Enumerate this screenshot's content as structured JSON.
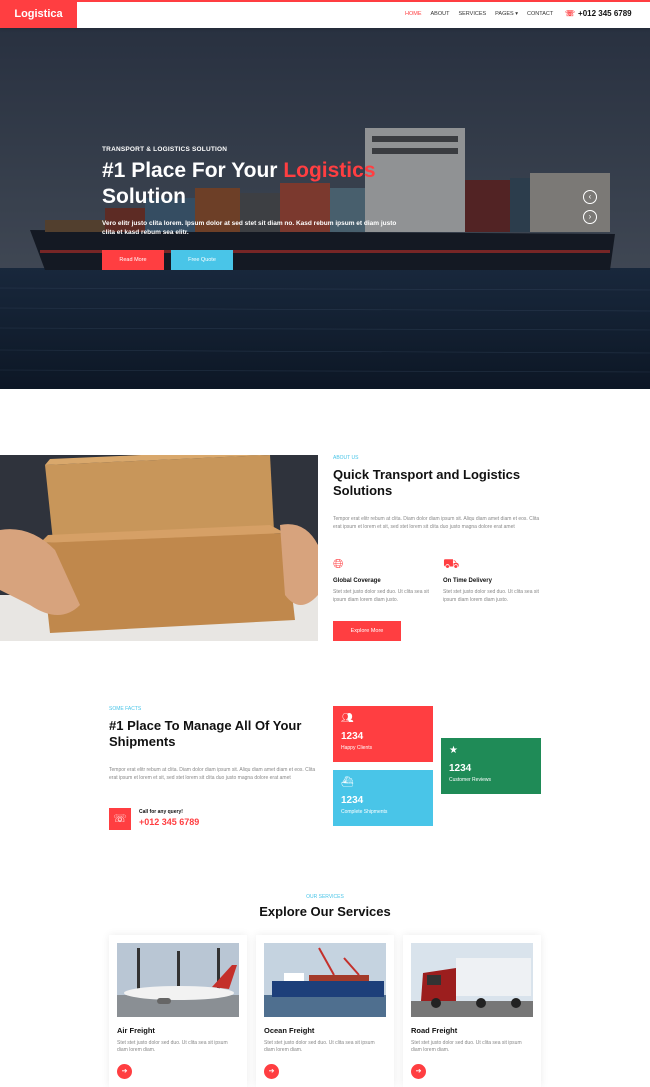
{
  "nav": {
    "brand": "Logistica",
    "items": [
      {
        "label": "HOME",
        "active": true
      },
      {
        "label": "ABOUT"
      },
      {
        "label": "SERVICES"
      },
      {
        "label": "PAGES ▾"
      },
      {
        "label": "CONTACT"
      }
    ],
    "phone": "+012 345 6789",
    "phone_icon": "headset-icon"
  },
  "hero": {
    "kicker": "TRANSPORT & LOGISTICS SOLUTION",
    "title_part1": "#1 Place For Your ",
    "title_highlight": "Logistics",
    "title_part2": "Solution",
    "text": "Vero elitr justo clita lorem. Ipsum dolor at sed stet sit diam no. Kasd rebum ipsum et diam justo clita et kasd rebum sea elitr.",
    "btn_primary": "Read More",
    "btn_secondary": "Free Quote",
    "prev_icon": "chevron-left-icon",
    "next_icon": "chevron-right-icon"
  },
  "about": {
    "kicker": "ABOUT US",
    "title": "Quick Transport and Logistics Solutions",
    "text": "Tempor erat elitr rebum at clita. Diam dolor diam ipsum sit. Aliqu diam amet diam et eos. Clita erat ipsum et lorem et sit, sed stet lorem sit clita duo justo magna dolore erat amet",
    "features": [
      {
        "icon": "globe-icon",
        "title": "Global Coverage",
        "text": "Stet stet justo dolor sed duo. Ut clita sea sit ipsum diam lorem diam justo."
      },
      {
        "icon": "truck-icon",
        "title": "On Time Delivery",
        "text": "Stet stet justo dolor sed duo. Ut clita sea sit ipsum diam lorem diam justo."
      }
    ],
    "btn": "Explore More"
  },
  "facts": {
    "kicker": "SOME FACTS",
    "title": "#1 Place To Manage All Of Your Shipments",
    "text": "Tempor erat elitr rebum at clita. Diam dolor diam ipsum sit. Aliqu diam amet diam et eos. Clita erat ipsum et lorem et sit, sed stet lorem sit clita duo justo magna dolore erat amet",
    "call_label": "Call for any query!",
    "call_phone": "+012 345 6789",
    "call_icon": "headset-icon",
    "stats": [
      {
        "icon": "users-icon",
        "value": "1234",
        "label": "Happy Clients",
        "color": "#ff3e41"
      },
      {
        "icon": "ship-icon",
        "value": "1234",
        "label": "Complete Shipments",
        "color": "#49c5e8"
      },
      {
        "icon": "star-icon",
        "value": "1234",
        "label": "Customer Reviews",
        "color": "#1f8b57"
      }
    ]
  },
  "services": {
    "kicker": "OUR SERVICES",
    "title": "Explore Our Services",
    "cards": [
      {
        "title": "Air Freight",
        "text": "Stet stet justo dolor sed duo. Ut clita sea sit ipsum diam lorem diam.",
        "icon": "arrow-right-icon"
      },
      {
        "title": "Ocean Freight",
        "text": "Stet stet justo dolor sed duo. Ut clita sea sit ipsum diam lorem diam.",
        "icon": "arrow-right-icon"
      },
      {
        "title": "Road Freight",
        "text": "Stet stet justo dolor sed duo. Ut clita sea sit ipsum diam lorem diam.",
        "icon": "arrow-right-icon"
      }
    ]
  },
  "colors": {
    "primary": "#ff3e41",
    "secondary": "#49c5e8",
    "green": "#1f8b57",
    "dark": "#111111"
  }
}
